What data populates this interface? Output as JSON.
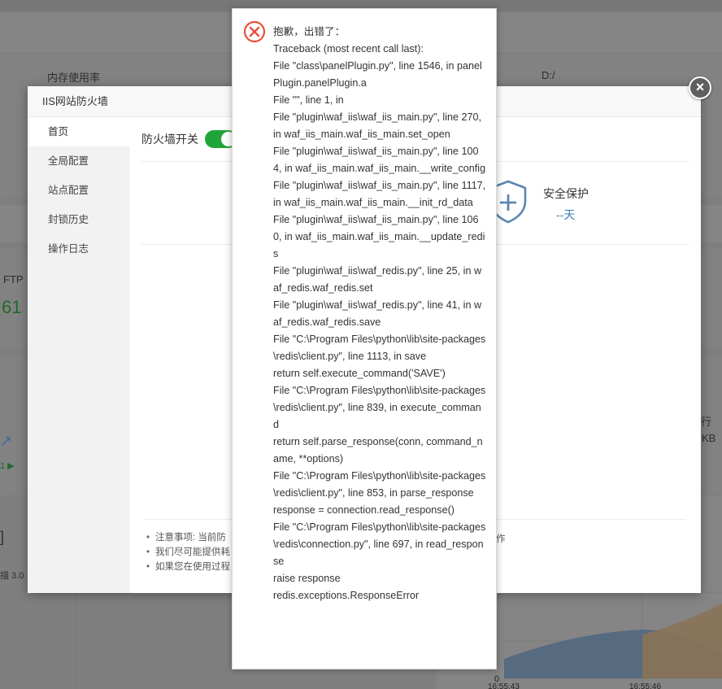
{
  "background": {
    "memory_label": "内存使用率",
    "disk_label": "D:/",
    "ftp_label": "FTP",
    "ftp_value": "61",
    "right_frag1": "行",
    "right_frag2": "KB",
    "left_frag": "描 3.0",
    "chart": {
      "y_labels": [
        "0"
      ],
      "x_labels": [
        "16:55:43",
        "16:55:46"
      ]
    }
  },
  "modal": {
    "title": "IIS网站防火墙",
    "menu": [
      "首页",
      "全局配置",
      "站点配置",
      "封锁历史",
      "操作日志"
    ],
    "firewall_switch_label": "防火墙开关",
    "firewall_on": true,
    "protect_title": "安全保护",
    "protect_days": "--天",
    "notes": [
      "注意事项: 当前防",
      "我们尽可能提供耗",
      "如果您在使用过程"
    ],
    "notes_tail": "作",
    "close_label": "×"
  },
  "error_dialog": {
    "title": "抱歉，出错了：",
    "icon": "error-circle-icon",
    "traceback": [
      "Traceback (most recent call last):",
      "File \"class\\panelPlugin.py\", line 1546, in panelPlugin.panelPlugin.a",
      "File \"\", line 1, in",
      "File \"plugin\\waf_iis\\waf_iis_main.py\", line 270, in waf_iis_main.waf_iis_main.set_open",
      "File \"plugin\\waf_iis\\waf_iis_main.py\", line 1004, in waf_iis_main.waf_iis_main.__write_config",
      "File \"plugin\\waf_iis\\waf_iis_main.py\", line 1117, in waf_iis_main.waf_iis_main.__init_rd_data",
      "File \"plugin\\waf_iis\\waf_iis_main.py\", line 1060, in waf_iis_main.waf_iis_main.__update_redis",
      "File \"plugin\\waf_iis\\waf_redis.py\", line 25, in waf_redis.waf_redis.set",
      "File \"plugin\\waf_iis\\waf_redis.py\", line 41, in waf_redis.waf_redis.save",
      "File \"C:\\Program Files\\python\\lib\\site-packages\\redis\\client.py\", line 1113, in save",
      "return self.execute_command('SAVE')",
      "File \"C:\\Program Files\\python\\lib\\site-packages\\redis\\client.py\", line 839, in execute_command",
      "return self.parse_response(conn, command_name, **options)",
      "File \"C:\\Program Files\\python\\lib\\site-packages\\redis\\client.py\", line 853, in parse_response",
      "response = connection.read_response()",
      "File \"C:\\Program Files\\python\\lib\\site-packages\\redis\\connection.py\", line 697, in read_response",
      "raise response",
      "redis.exceptions.ResponseError"
    ]
  }
}
